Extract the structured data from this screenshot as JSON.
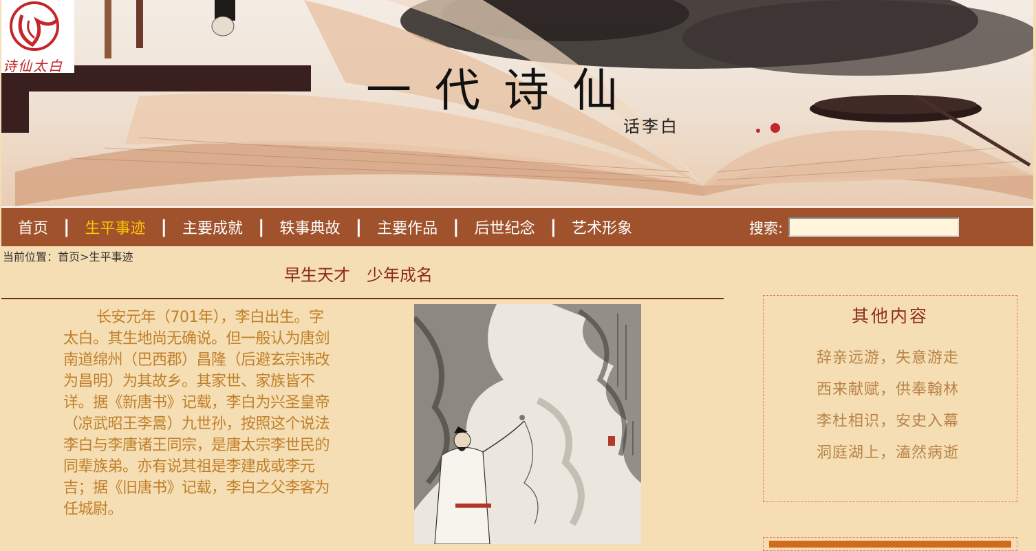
{
  "banner": {
    "logo_text": "诗仙太白",
    "title": "一代诗仙",
    "subtitle": "话李白"
  },
  "nav": {
    "items": [
      {
        "label": "首页",
        "active": false
      },
      {
        "label": "生平事迹",
        "active": true
      },
      {
        "label": "主要成就",
        "active": false
      },
      {
        "label": "轶事典故",
        "active": false
      },
      {
        "label": "主要作品",
        "active": false
      },
      {
        "label": "后世纪念",
        "active": false
      },
      {
        "label": "艺术形象",
        "active": false
      }
    ],
    "separator": "|",
    "search_label": "搜索:",
    "search_value": ""
  },
  "breadcrumb": {
    "prefix": "当前位置：",
    "home": "首页",
    "arrow": ">",
    "current": "生平事迹"
  },
  "article": {
    "title": "早生天才　少年成名",
    "paragraph": "长安元年（701年），李白出生。字太白。其生地尚无确说。但一般认为唐剑南道绵州（巴西郡）昌隆（后避玄宗讳改为昌明）为其故乡。其家世、家族皆不详。据《新唐书》记载，李白为兴圣皇帝（凉武昭王李暠）九世孙，按照这个说法李白与李唐诸王同宗，是唐太宗李世民的同辈族弟。亦有说其祖是李建成或李元吉；据《旧唐书》记载，李白之父李客为任城尉。"
  },
  "sidebar": {
    "title": "其他内容",
    "items": [
      "辞亲远游，失意游走",
      "西来献赋，供奉翰林",
      "李杜相识，安史入幕",
      "洞庭湖上，溘然病逝"
    ]
  },
  "colors": {
    "page_bg": "#f5deb3",
    "nav_bg": "#a0522d",
    "nav_active": "#ffc400",
    "article_text": "#c07f2a",
    "title_color": "#8b2a1a"
  }
}
